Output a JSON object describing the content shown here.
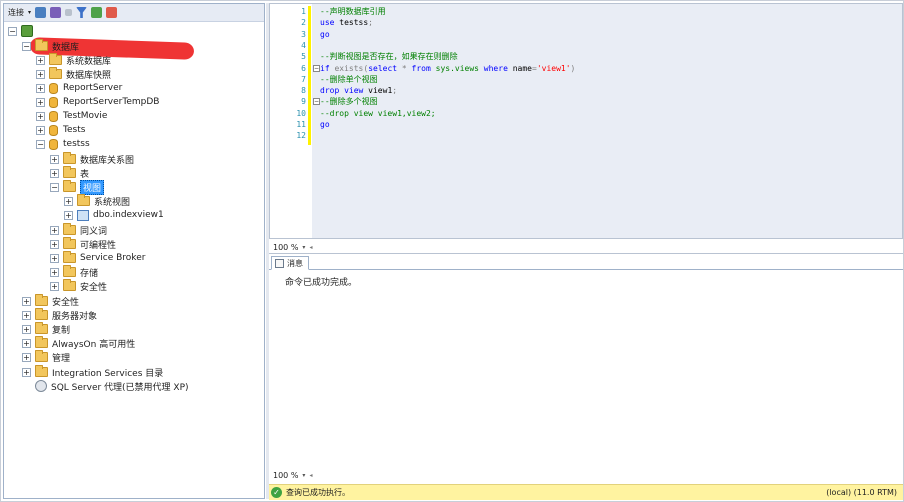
{
  "toolbar": {
    "connect_label": "连接",
    "icons": [
      "connect-object-explorer-icon",
      "disconnect-icon",
      "stop-icon",
      "filter-icon",
      "refresh-icon",
      "activity-monitor-icon"
    ]
  },
  "tree": {
    "databases": "数据库",
    "system_databases": "系统数据库",
    "database_snapshots": "数据库快照",
    "report_server": "ReportServer",
    "report_server_temp": "ReportServerTempDB",
    "test_movie": "TestMovie",
    "tests": "Tests",
    "testss": "testss",
    "db_diagrams": "数据库关系图",
    "tables": "表",
    "views": "视图",
    "system_views": "系统视图",
    "indexview": "dbo.indexview1",
    "synonyms": "同义词",
    "programmability": "可编程性",
    "service_broker": "Service Broker",
    "storage": "存储",
    "db_security": "安全性",
    "security": "安全性",
    "server_objects": "服务器对象",
    "replication": "复制",
    "always_on": "AlwaysOn 高可用性",
    "management": "管理",
    "integration_services": "Integration Services 目录",
    "sql_agent": "SQL Server 代理(已禁用代理 XP)"
  },
  "editor": {
    "lines": [
      {
        "n": "1",
        "text": "--声明数据库引用"
      },
      {
        "n": "2",
        "text": "use testss"
      },
      {
        "n": "3",
        "text": "go"
      },
      {
        "n": "4",
        "text": ""
      },
      {
        "n": "5",
        "text": "--判断视图是否存在，如果存在则删除"
      },
      {
        "n": "6",
        "text": "if exists(select * from sys.views where name='view1')"
      },
      {
        "n": "7",
        "text": "--删除单个视图"
      },
      {
        "n": "8",
        "text": "drop view view1;"
      },
      {
        "n": "9",
        "text": "--删除多个视图"
      },
      {
        "n": "10",
        "text": "--drop view view1,view2;"
      },
      {
        "n": "11",
        "text": "go"
      },
      {
        "n": "12",
        "text": ""
      }
    ],
    "line2_kw": "use",
    "line2_id": " testss",
    "line2_op": ";",
    "line3": "go",
    "line6_if": "if ",
    "line6_exists": "exists",
    "line6_p1": "(",
    "line6_select": "select",
    "line6_star": " * ",
    "line6_from": "from",
    "line6_sys": " sys.views ",
    "line6_where": "where",
    "line6_name": " name",
    "line6_eq": "=",
    "line6_str": "'view1'",
    "line6_p2": ")",
    "line8_drop": "drop view",
    "line8_id": " view1",
    "line8_semi": ";",
    "line11": "go",
    "zoom": "100 %"
  },
  "results": {
    "tab_messages": "消息",
    "message": "命令已成功完成。",
    "zoom": "100 %"
  },
  "status": {
    "query_ok": "查询已成功执行。",
    "server": "(local) (11.0 RTM)"
  }
}
